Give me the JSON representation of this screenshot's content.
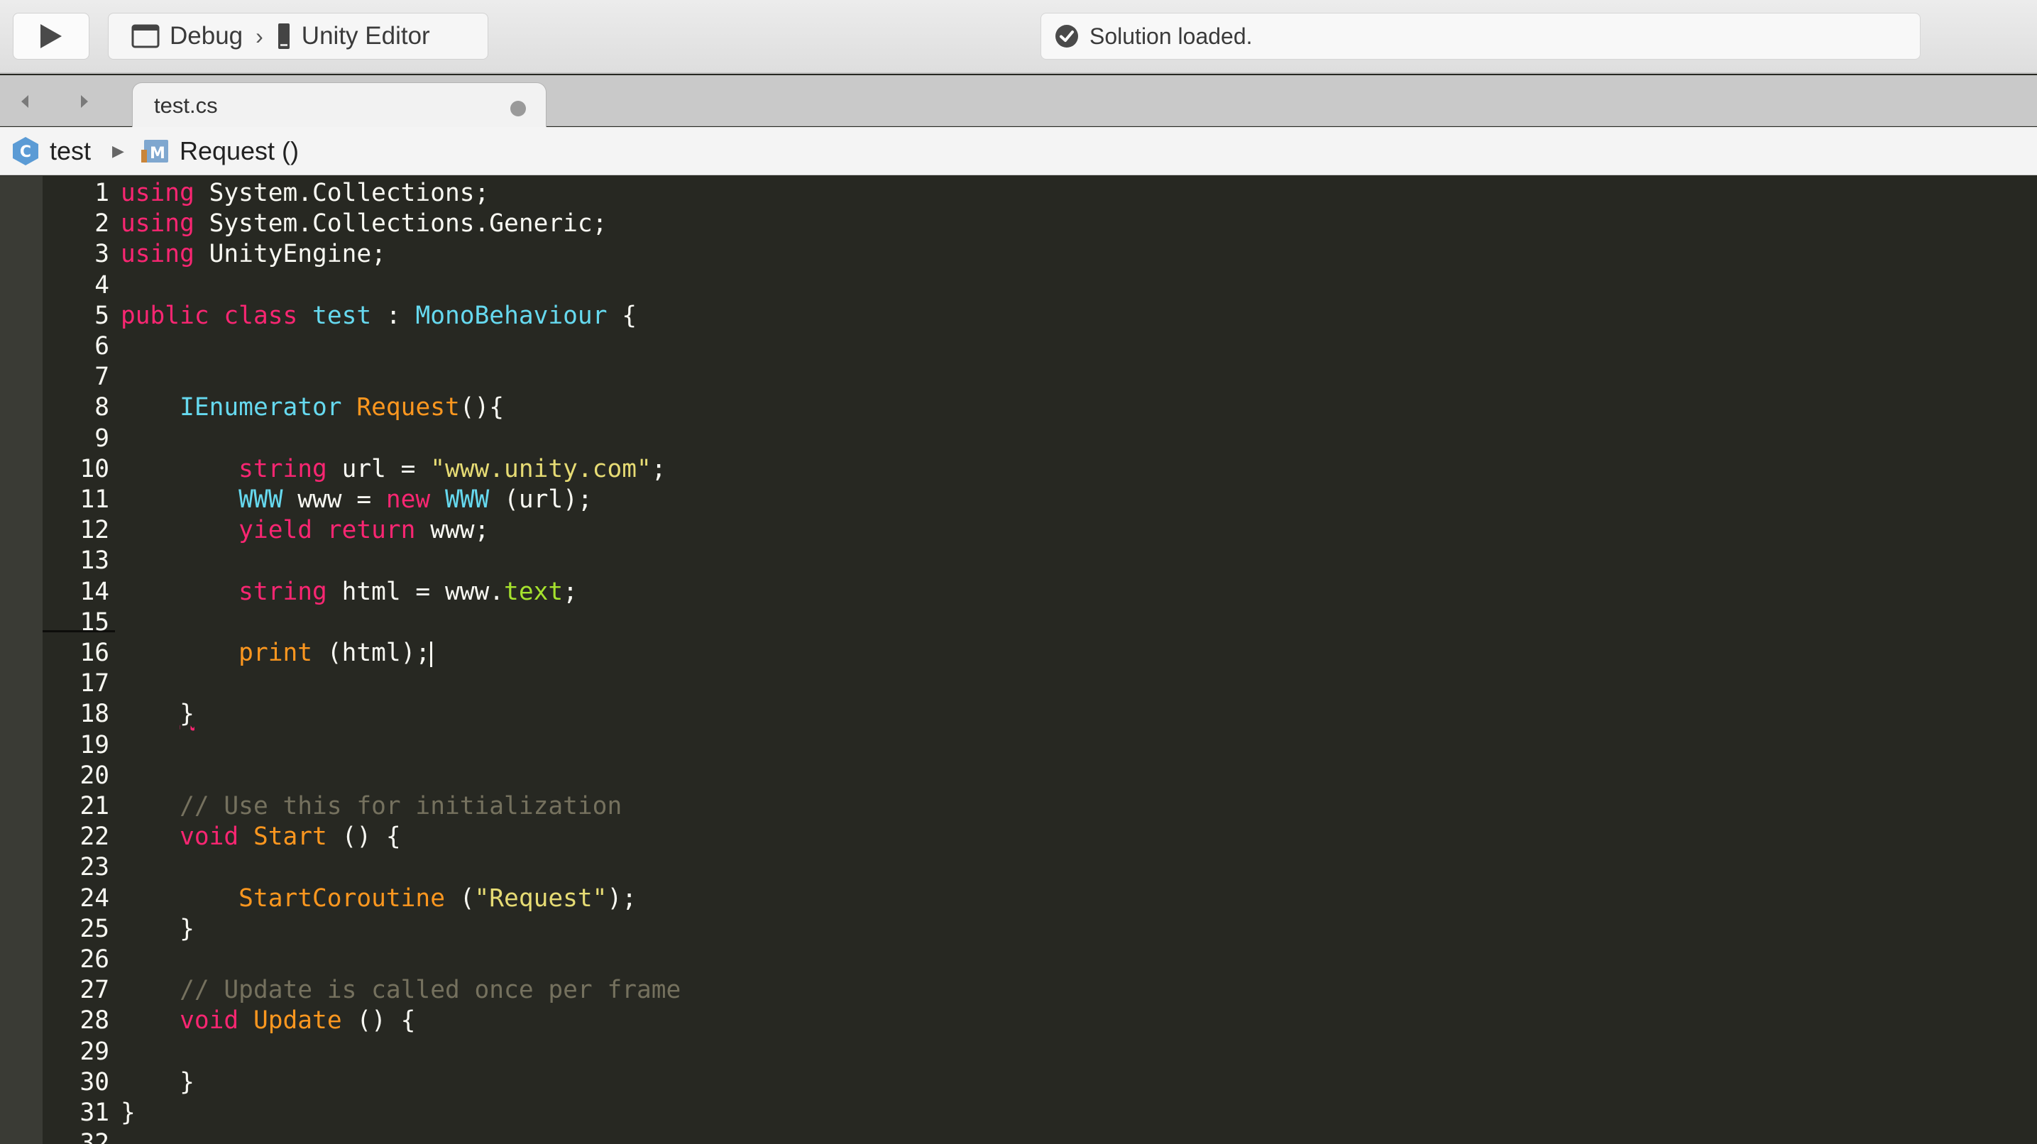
{
  "toolbar": {
    "configuration": "Debug",
    "separator": "›",
    "target": "Unity Editor",
    "status": "Solution loaded."
  },
  "tabs": [
    {
      "label": "test.cs",
      "modified": true
    }
  ],
  "breadcrumb": {
    "class_name": "test",
    "method_name": "Request ()"
  },
  "editor": {
    "current_line": 16,
    "lines": [
      {
        "n": "1",
        "tokens": [
          [
            "kw",
            "using"
          ],
          [
            "plain",
            " System.Collections;"
          ]
        ]
      },
      {
        "n": "2",
        "tokens": [
          [
            "kw",
            "using"
          ],
          [
            "plain",
            " System.Collections.Generic;"
          ]
        ]
      },
      {
        "n": "3",
        "tokens": [
          [
            "kw",
            "using"
          ],
          [
            "plain",
            " UnityEngine;"
          ]
        ]
      },
      {
        "n": "4",
        "tokens": []
      },
      {
        "n": "5",
        "tokens": [
          [
            "kw",
            "public"
          ],
          [
            "plain",
            " "
          ],
          [
            "kw",
            "class"
          ],
          [
            "plain",
            " "
          ],
          [
            "type",
            "test"
          ],
          [
            "plain",
            " : "
          ],
          [
            "type",
            "MonoBehaviour"
          ],
          [
            "plain",
            " {"
          ]
        ]
      },
      {
        "n": "6",
        "tokens": []
      },
      {
        "n": "7",
        "tokens": []
      },
      {
        "n": "8",
        "tokens": [
          [
            "plain",
            "    "
          ],
          [
            "type",
            "IEnumerator"
          ],
          [
            "plain",
            " "
          ],
          [
            "fn",
            "Request"
          ],
          [
            "plain",
            "(){"
          ]
        ]
      },
      {
        "n": "9",
        "tokens": []
      },
      {
        "n": "10",
        "tokens": [
          [
            "plain",
            "        "
          ],
          [
            "kw",
            "string"
          ],
          [
            "plain",
            " url = "
          ],
          [
            "str",
            "\"www.unity.com\""
          ],
          [
            "plain",
            ";"
          ]
        ]
      },
      {
        "n": "11",
        "tokens": [
          [
            "plain",
            "        "
          ],
          [
            "type",
            "WWW"
          ],
          [
            "plain",
            " www = "
          ],
          [
            "kw",
            "new"
          ],
          [
            "plain",
            " "
          ],
          [
            "type",
            "WWW"
          ],
          [
            "plain",
            " (url);"
          ]
        ]
      },
      {
        "n": "12",
        "tokens": [
          [
            "plain",
            "        "
          ],
          [
            "kw",
            "yield"
          ],
          [
            "plain",
            " "
          ],
          [
            "kw",
            "return"
          ],
          [
            "plain",
            " www;"
          ]
        ]
      },
      {
        "n": "13",
        "tokens": []
      },
      {
        "n": "14",
        "tokens": [
          [
            "plain",
            "        "
          ],
          [
            "kw",
            "string"
          ],
          [
            "plain",
            " html = www."
          ],
          [
            "prop",
            "text"
          ],
          [
            "plain",
            ";"
          ]
        ]
      },
      {
        "n": "15",
        "tokens": []
      },
      {
        "n": "16",
        "tokens": [
          [
            "plain",
            "        "
          ],
          [
            "fn",
            "print"
          ],
          [
            "plain",
            " (html);"
          ],
          [
            "caret",
            ""
          ]
        ]
      },
      {
        "n": "17",
        "tokens": []
      },
      {
        "n": "18",
        "tokens": [
          [
            "plain",
            "    "
          ],
          [
            "err",
            "}"
          ]
        ]
      },
      {
        "n": "19",
        "tokens": []
      },
      {
        "n": "20",
        "tokens": []
      },
      {
        "n": "21",
        "tokens": [
          [
            "plain",
            "    "
          ],
          [
            "cm",
            "// Use this for initialization"
          ]
        ]
      },
      {
        "n": "22",
        "tokens": [
          [
            "plain",
            "    "
          ],
          [
            "kw",
            "void"
          ],
          [
            "plain",
            " "
          ],
          [
            "fn",
            "Start"
          ],
          [
            "plain",
            " () {"
          ]
        ]
      },
      {
        "n": "23",
        "tokens": []
      },
      {
        "n": "24",
        "tokens": [
          [
            "plain",
            "        "
          ],
          [
            "fn",
            "StartCoroutine"
          ],
          [
            "plain",
            " ("
          ],
          [
            "str",
            "\"Request\""
          ],
          [
            "plain",
            ");"
          ]
        ]
      },
      {
        "n": "25",
        "tokens": [
          [
            "plain",
            "    }"
          ]
        ]
      },
      {
        "n": "26",
        "tokens": []
      },
      {
        "n": "27",
        "tokens": [
          [
            "plain",
            "    "
          ],
          [
            "cm",
            "// Update is called once per frame"
          ]
        ]
      },
      {
        "n": "28",
        "tokens": [
          [
            "plain",
            "    "
          ],
          [
            "kw",
            "void"
          ],
          [
            "plain",
            " "
          ],
          [
            "fn",
            "Update"
          ],
          [
            "plain",
            " () {"
          ]
        ]
      },
      {
        "n": "29",
        "tokens": []
      },
      {
        "n": "30",
        "tokens": [
          [
            "plain",
            "    }"
          ]
        ]
      },
      {
        "n": "31",
        "tokens": [
          [
            "plain",
            "}"
          ]
        ]
      },
      {
        "n": "32",
        "tokens": []
      }
    ]
  }
}
